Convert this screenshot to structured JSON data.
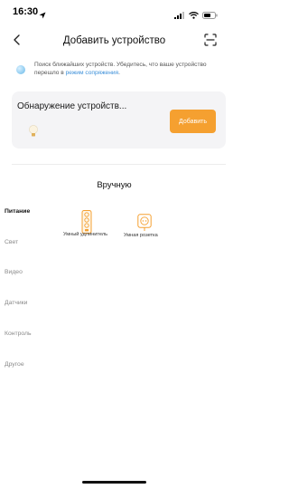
{
  "status_bar": {
    "time": "16:30"
  },
  "nav": {
    "title": "Добавить устройство"
  },
  "hint": {
    "text": "Поиск ближайших устройств. Убедитесь, что ваше устройство перешло в",
    "link": "режим сопряжения",
    "end": "."
  },
  "discovery": {
    "title": "Обнаружение устройств...",
    "add_label": "Добавить"
  },
  "manual": {
    "title": "Вручную"
  },
  "categories": [
    "Питание",
    "Свет",
    "Видео",
    "Датчики",
    "Контроль",
    "Другое"
  ],
  "devices": [
    {
      "label": "Умный удлинитель",
      "icon": "power-strip-icon"
    },
    {
      "label": "Умная розетка",
      "icon": "smart-socket-icon"
    }
  ],
  "colors": {
    "accent": "#f5a030",
    "link": "#3b8fd9",
    "card": "#f4f4f6"
  }
}
